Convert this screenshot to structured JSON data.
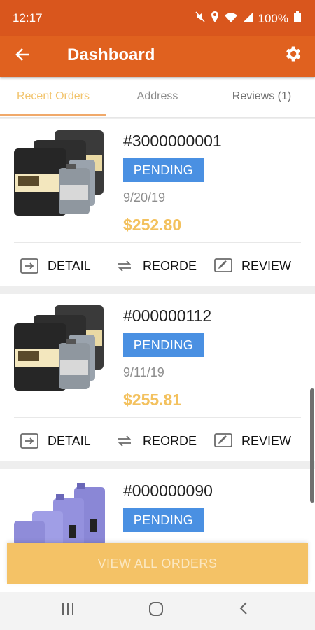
{
  "status_bar": {
    "time": "12:17",
    "battery": "100%"
  },
  "app_bar": {
    "title": "Dashboard"
  },
  "tabs": [
    {
      "label": "Recent Orders"
    },
    {
      "label": "Address"
    },
    {
      "label": "Reviews (1)"
    }
  ],
  "orders": [
    {
      "number": "#3000000001",
      "status": "PENDING",
      "date": "9/20/19",
      "total": "$252.80"
    },
    {
      "number": "#000000112",
      "status": "PENDING",
      "date": "9/11/19",
      "total": "$255.81"
    },
    {
      "number": "#000000090",
      "status": "PENDING"
    }
  ],
  "actions": {
    "detail": "DETAIL",
    "reorder": "REORDE",
    "review": "REVIEW"
  },
  "view_all_label": "VIEW ALL ORDERS",
  "colors": {
    "primary": "#e0611f",
    "accent": "#f3c15e",
    "badge": "#4a90e2"
  }
}
